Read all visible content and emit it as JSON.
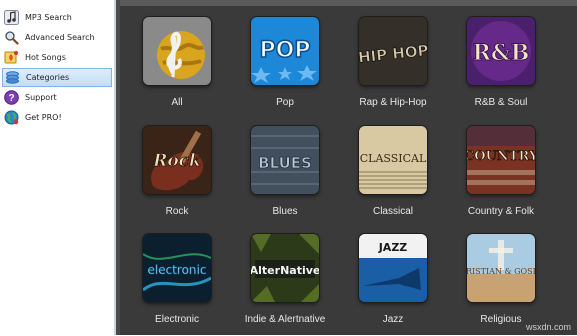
{
  "sidebar": {
    "items": [
      {
        "label": "MP3 Search",
        "icon": "music-note-icon",
        "active": false
      },
      {
        "label": "Advanced Search",
        "icon": "magnifier-icon",
        "active": false
      },
      {
        "label": "Hot Songs",
        "icon": "hot-songs-icon",
        "active": false
      },
      {
        "label": "Categories",
        "icon": "categories-icon",
        "active": true
      },
      {
        "label": "Support",
        "icon": "help-icon",
        "active": false
      },
      {
        "label": "Get PRO!",
        "icon": "globe-icon",
        "active": false
      }
    ]
  },
  "categories": [
    {
      "label": "All",
      "art_text": "",
      "icon": "globe-treble-clef-icon"
    },
    {
      "label": "Pop",
      "art_text": "POP",
      "icon": "pop-art-icon"
    },
    {
      "label": "Rap & Hip-Hop",
      "art_text": "HIP HOP",
      "icon": "hip-hop-art-icon"
    },
    {
      "label": "R&B & Soul",
      "art_text": "R&B",
      "icon": "rnb-art-icon"
    },
    {
      "label": "Rock",
      "art_text": "Rock",
      "icon": "rock-guitar-art-icon"
    },
    {
      "label": "Blues",
      "art_text": "BLUES",
      "icon": "blues-art-icon"
    },
    {
      "label": "Classical",
      "art_text": "CLASSICAL",
      "icon": "classical-art-icon"
    },
    {
      "label": "Country & Folk",
      "art_text": "COUNTRY",
      "icon": "country-art-icon"
    },
    {
      "label": "Electronic",
      "art_text": "electronic",
      "icon": "electronic-art-icon"
    },
    {
      "label": "Indie & Alertnative",
      "art_text": "AlterNative",
      "icon": "indie-art-icon"
    },
    {
      "label": "Jazz",
      "art_text": "JAZZ",
      "icon": "jazz-trumpet-art-icon"
    },
    {
      "label": "Religious",
      "art_text": "CHRISTIAN & GOSPEL",
      "icon": "religious-art-icon"
    }
  ],
  "watermark": "wsxdn.com",
  "colors": {
    "main_bg": "#3a3a3a",
    "sidebar_bg": "#ffffff",
    "active_item_bg": "#c2dcf7",
    "label_text": "#e8e8e8"
  }
}
